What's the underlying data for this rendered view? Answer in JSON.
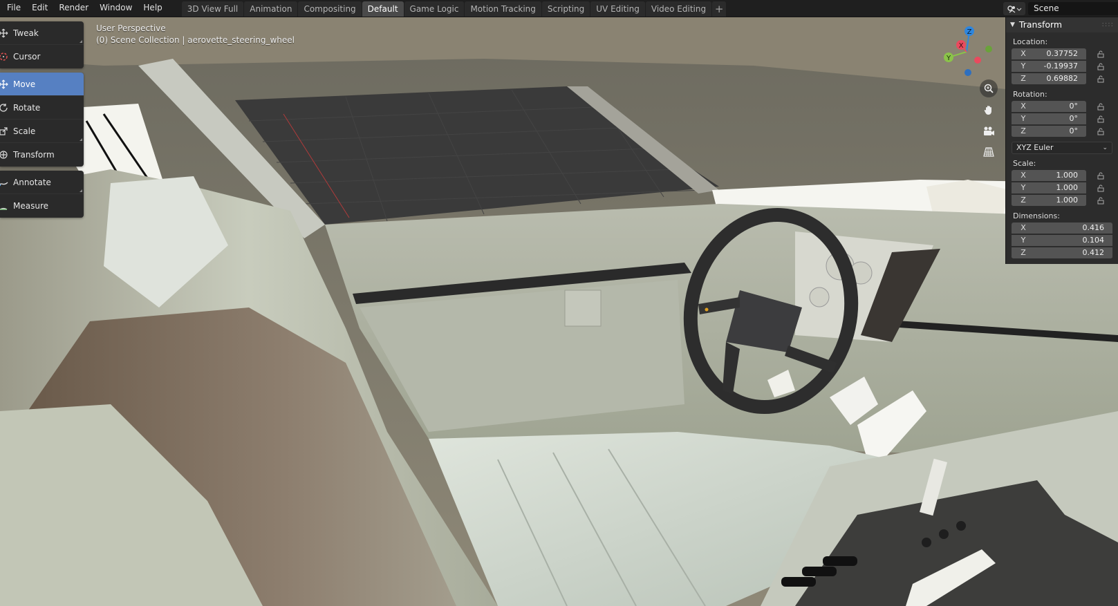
{
  "menu": [
    "File",
    "Edit",
    "Render",
    "Window",
    "Help"
  ],
  "workspace_tabs": [
    {
      "label": "3D View Full"
    },
    {
      "label": "Animation"
    },
    {
      "label": "Compositing"
    },
    {
      "label": "Default",
      "active": true
    },
    {
      "label": "Game Logic"
    },
    {
      "label": "Motion Tracking"
    },
    {
      "label": "Scripting"
    },
    {
      "label": "UV Editing"
    },
    {
      "label": "Video Editing"
    }
  ],
  "add_tab_label": "+",
  "scene": {
    "name": "Scene",
    "icon": "scene-icon"
  },
  "viewport": {
    "perspective": "User Perspective",
    "collection_info": "(0) Scene Collection | aerovette_steering_wheel"
  },
  "toolbar": {
    "group1": [
      {
        "label": "Tweak",
        "icon": "tweak-icon"
      },
      {
        "label": "Cursor",
        "icon": "cursor-icon"
      }
    ],
    "group2": [
      {
        "label": "Move",
        "icon": "move-icon",
        "active": true
      },
      {
        "label": "Rotate",
        "icon": "rotate-icon"
      },
      {
        "label": "Scale",
        "icon": "scale-icon"
      },
      {
        "label": "Transform",
        "icon": "transform-icon"
      }
    ],
    "group3": [
      {
        "label": "Annotate",
        "icon": "annotate-icon"
      },
      {
        "label": "Measure",
        "icon": "measure-icon"
      }
    ]
  },
  "gizmo": {
    "x": "X",
    "y": "Y",
    "z": "Z",
    "colors": {
      "x": "#e94a5e",
      "y": "#8bc34a",
      "z": "#2e86de"
    }
  },
  "transform_panel": {
    "title": "Transform",
    "location": {
      "label": "Location:",
      "x": "0.37752",
      "y": "-0.19937",
      "z": "0.69882"
    },
    "rotation": {
      "label": "Rotation:",
      "x": "0°",
      "y": "0°",
      "z": "0°"
    },
    "rotation_mode": "XYZ Euler",
    "scale": {
      "label": "Scale:",
      "x": "1.000",
      "y": "1.000",
      "z": "1.000"
    },
    "dimensions": {
      "label": "Dimensions:",
      "x": "0.416",
      "y": "0.104",
      "z": "0.412"
    },
    "axis_labels": {
      "x": "X",
      "y": "Y",
      "z": "Z"
    }
  },
  "colors": {
    "accent": "#5680c2",
    "topbar": "#1f1f1f",
    "panel": "#2c2c2c"
  }
}
